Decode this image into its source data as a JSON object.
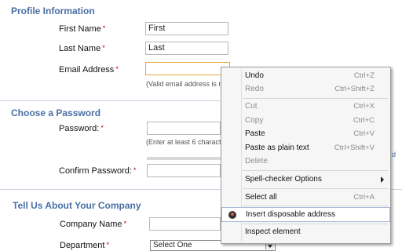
{
  "sections": {
    "profile": "Profile Information",
    "password": "Choose a Password",
    "company": "Tell Us About Your Company"
  },
  "profile": {
    "first_name_label": "First Name",
    "first_name_value": "First",
    "last_name_label": "Last Name",
    "last_name_value": "Last",
    "email_label": "Email Address",
    "email_value": "",
    "email_hint": "(Valid email address is re"
  },
  "password": {
    "password_label": "Password:",
    "password_hint": "(Enter at least 6 charact",
    "confirm_label": "Confirm Password:",
    "side_fragment": "d"
  },
  "company": {
    "company_name_label": "Company Name",
    "department_label": "Department",
    "department_selected": "Select One"
  },
  "required_mark": "*",
  "context_menu": {
    "items": [
      {
        "label": "Undo",
        "shortcut": "Ctrl+Z",
        "disabled": false
      },
      {
        "label": "Redo",
        "shortcut": "Ctrl+Shift+Z",
        "disabled": true
      },
      {
        "label": "Cut",
        "shortcut": "Ctrl+X",
        "disabled": true
      },
      {
        "label": "Copy",
        "shortcut": "Ctrl+C",
        "disabled": true
      },
      {
        "label": "Paste",
        "shortcut": "Ctrl+V",
        "disabled": false
      },
      {
        "label": "Paste as plain text",
        "shortcut": "Ctrl+Shift+V",
        "disabled": false
      },
      {
        "label": "Delete",
        "shortcut": "",
        "disabled": true
      },
      {
        "label": "Spell-checker Options",
        "shortcut": "",
        "disabled": false
      },
      {
        "label": "Select all",
        "shortcut": "Ctrl+A",
        "disabled": false
      },
      {
        "label": "Insert disposable address",
        "shortcut": "",
        "disabled": false,
        "icon": "disposable-address-icon"
      },
      {
        "label": "Inspect element",
        "shortcut": "",
        "disabled": false
      }
    ]
  },
  "colors": {
    "section_title": "#4a6fa5",
    "required": "#cc0000",
    "focus_border": "#e8a33b"
  }
}
